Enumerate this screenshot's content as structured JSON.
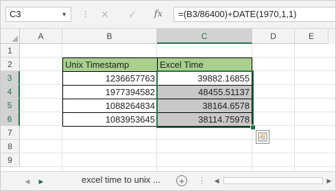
{
  "formula_bar": {
    "name_box": "C3",
    "formula": "=(B3/86400)+DATE(1970,1,1)",
    "cancel_glyph": "✕",
    "enter_glyph": "✓",
    "fx_glyph": "fx"
  },
  "columns": [
    "A",
    "B",
    "C",
    "D",
    "E"
  ],
  "rows": [
    "1",
    "2",
    "3",
    "4",
    "5",
    "6",
    "7",
    "8",
    "9"
  ],
  "table": {
    "headers": [
      "Unix Timestamp",
      "Excel Time"
    ],
    "rows": [
      {
        "timestamp": "1236657763",
        "excel_time": "39882.16855"
      },
      {
        "timestamp": "1977394582",
        "excel_time": "48455.51137"
      },
      {
        "timestamp": "1088264834",
        "excel_time": "38164.6578"
      },
      {
        "timestamp": "1083953645",
        "excel_time": "38114.75978"
      }
    ]
  },
  "sheet_tabs": {
    "active": "excel time to unix",
    "overflow": "...",
    "add_glyph": "+"
  },
  "colors": {
    "header_fill": "#a9d08e",
    "selection": "#217346",
    "shaded_cell": "#c8c8c8"
  },
  "icons": {
    "quick_analysis": "quick-analysis-icon",
    "next_sheet": "triangle-right-icon"
  }
}
